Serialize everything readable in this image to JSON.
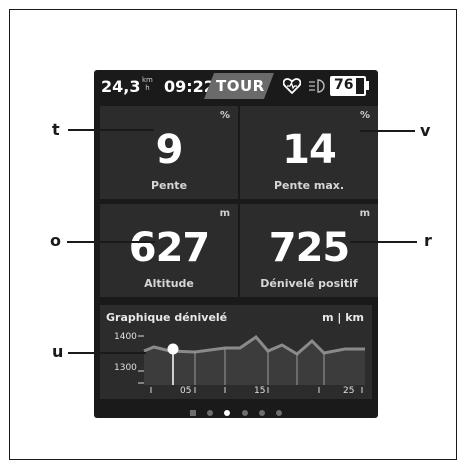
{
  "status": {
    "speed": "24,3",
    "speed_unit_top": "km",
    "speed_unit_bottom": "h",
    "time": "09:22",
    "mode": "TOUR",
    "battery": "76",
    "battery_unit": "%",
    "battery_level": 0.76
  },
  "tiles": [
    {
      "unit": "%",
      "value": "9",
      "label": "Pente"
    },
    {
      "unit": "%",
      "value": "14",
      "label": "Pente max."
    },
    {
      "unit": "m",
      "value": "627",
      "label": "Altitude"
    },
    {
      "unit": "m",
      "value": "725",
      "label": "Dénivelé positif"
    }
  ],
  "graph": {
    "title": "Graphique dénivelé",
    "units": "m | km",
    "y_ticks": [
      "1400",
      "1300"
    ],
    "x_ticks": [
      "05",
      "15",
      "25"
    ]
  },
  "callouts": [
    "t",
    "v",
    "o",
    "r",
    "u"
  ],
  "pager": {
    "count": 6,
    "active": 2
  }
}
